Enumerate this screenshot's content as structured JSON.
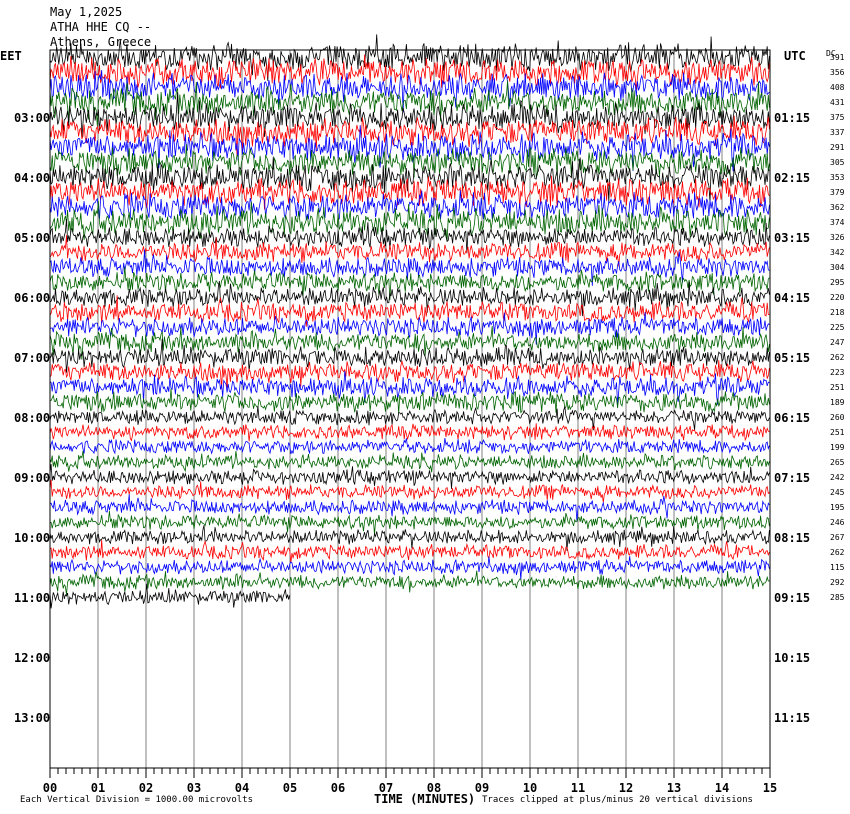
{
  "header": {
    "date": "May 1,2025",
    "station": "ATHA HHE CQ --",
    "subtitle": "Athens, Greece"
  },
  "labels": {
    "left_timezone": "EET",
    "right_timezone": "UTC",
    "dc_header": "DC",
    "xlabel": "TIME (MINUTES)",
    "scale_note": "Each Vertical Division = 1000.00 microvolts",
    "clip_note": "Traces clipped at plus/minus 20 vertical divisions"
  },
  "chart_data": {
    "type": "line",
    "title": "",
    "xlabel": "TIME (MINUTES)",
    "xlim": [
      0,
      15
    ],
    "x_ticks": [
      "00",
      "01",
      "02",
      "03",
      "04",
      "05",
      "06",
      "07",
      "08",
      "09",
      "10",
      "11",
      "12",
      "13",
      "14",
      "15"
    ],
    "left_hour_labels": [
      "03:00",
      "04:00",
      "05:00",
      "06:00",
      "07:00",
      "08:00",
      "09:00",
      "10:00",
      "11:00",
      "12:00",
      "13:00"
    ],
    "right_hour_labels": [
      "01:15",
      "02:15",
      "03:15",
      "04:15",
      "05:15",
      "06:15",
      "07:15",
      "08:15",
      "09:15",
      "10:15",
      "11:15"
    ],
    "trace_colors": [
      "#000000",
      "#ff0000",
      "#0000ff",
      "#006400"
    ],
    "trace_count": 37,
    "last_trace_minutes": 5,
    "dc_offsets": [
      391,
      356,
      408,
      431,
      375,
      337,
      291,
      305,
      353,
      379,
      362,
      374,
      326,
      342,
      304,
      295,
      220,
      218,
      225,
      247,
      262,
      223,
      251,
      189,
      260,
      251,
      199,
      265,
      242,
      245,
      195,
      246,
      267,
      262,
      115,
      292,
      285
    ]
  }
}
